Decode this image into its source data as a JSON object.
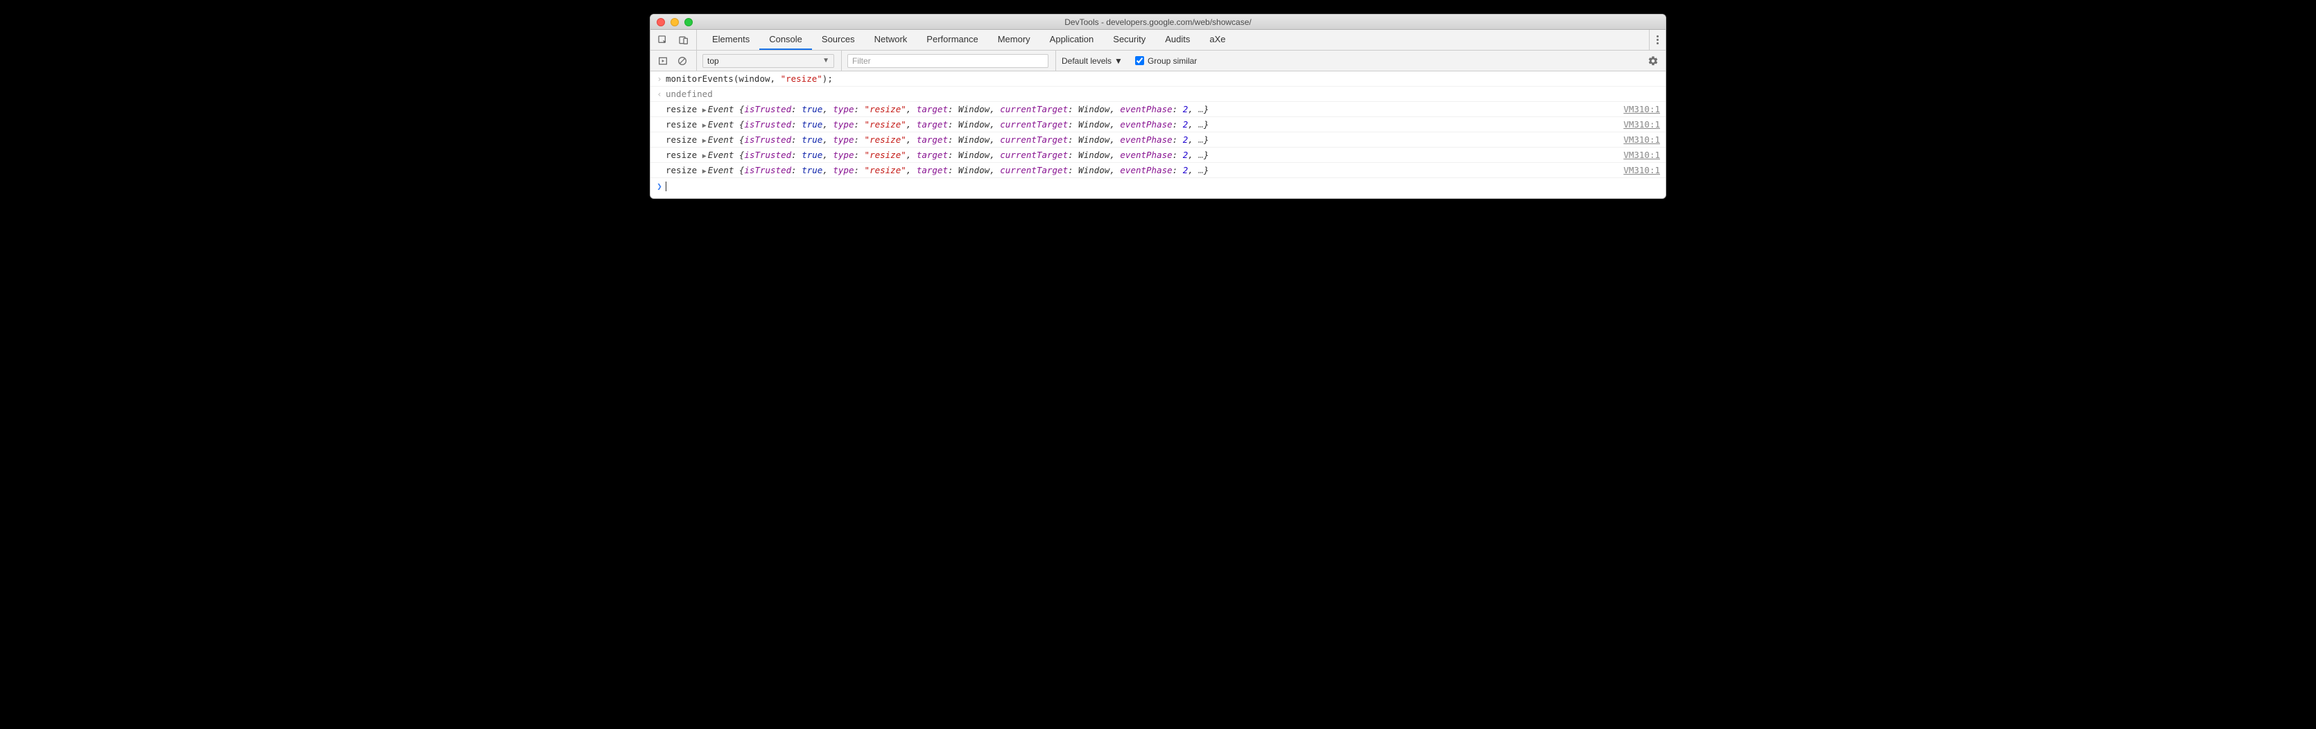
{
  "window": {
    "title": "DevTools - developers.google.com/web/showcase/"
  },
  "tabs": {
    "items": [
      {
        "label": "Elements"
      },
      {
        "label": "Console"
      },
      {
        "label": "Sources"
      },
      {
        "label": "Network"
      },
      {
        "label": "Performance"
      },
      {
        "label": "Memory"
      },
      {
        "label": "Application"
      },
      {
        "label": "Security"
      },
      {
        "label": "Audits"
      },
      {
        "label": "aXe"
      }
    ],
    "active_index": 1
  },
  "toolbar": {
    "context": "top",
    "filter_placeholder": "Filter",
    "filter_value": "",
    "levels_label": "Default levels",
    "group_similar_label": "Group similar",
    "group_similar_checked": true
  },
  "console": {
    "input": {
      "prefix": "monitorEvents(window, ",
      "arg_string": "\"resize\"",
      "suffix": ");"
    },
    "return_value": "undefined",
    "events": [
      {
        "label": "resize",
        "obj": "Event",
        "props": {
          "isTrusted": "true",
          "type": "\"resize\"",
          "target": "Window",
          "currentTarget": "Window",
          "eventPhase": "2"
        },
        "source": "VM310:1"
      },
      {
        "label": "resize",
        "obj": "Event",
        "props": {
          "isTrusted": "true",
          "type": "\"resize\"",
          "target": "Window",
          "currentTarget": "Window",
          "eventPhase": "2"
        },
        "source": "VM310:1"
      },
      {
        "label": "resize",
        "obj": "Event",
        "props": {
          "isTrusted": "true",
          "type": "\"resize\"",
          "target": "Window",
          "currentTarget": "Window",
          "eventPhase": "2"
        },
        "source": "VM310:1"
      },
      {
        "label": "resize",
        "obj": "Event",
        "props": {
          "isTrusted": "true",
          "type": "\"resize\"",
          "target": "Window",
          "currentTarget": "Window",
          "eventPhase": "2"
        },
        "source": "VM310:1"
      },
      {
        "label": "resize",
        "obj": "Event",
        "props": {
          "isTrusted": "true",
          "type": "\"resize\"",
          "target": "Window",
          "currentTarget": "Window",
          "eventPhase": "2"
        },
        "source": "VM310:1"
      }
    ],
    "prompt_symbol": "❯"
  }
}
